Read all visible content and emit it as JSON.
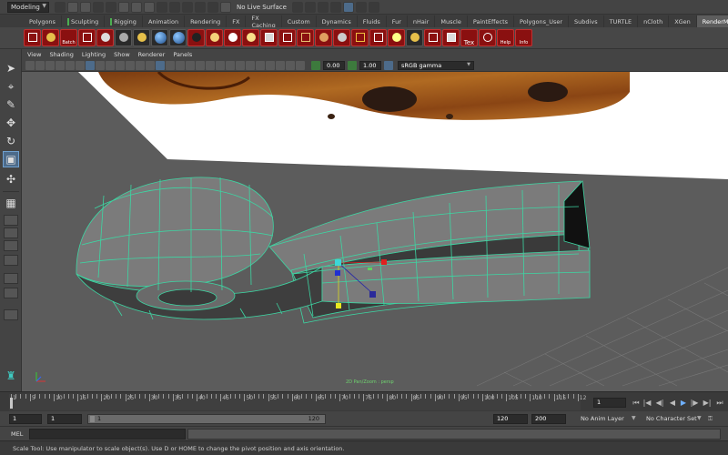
{
  "status_line": {
    "mode": "Modeling",
    "surface": "No Live Surface"
  },
  "shelf_tabs": [
    {
      "label": "Polygons",
      "active": false,
      "mark": false
    },
    {
      "label": "Sculpting",
      "active": false,
      "mark": true
    },
    {
      "label": "Rigging",
      "active": false,
      "mark": true
    },
    {
      "label": "Animation",
      "active": false,
      "mark": false
    },
    {
      "label": "Rendering",
      "active": false,
      "mark": false
    },
    {
      "label": "FX",
      "active": false,
      "mark": false
    },
    {
      "label": "FX Caching",
      "active": false,
      "mark": false
    },
    {
      "label": "Custom",
      "active": false,
      "mark": false
    },
    {
      "label": "Dynamics",
      "active": false,
      "mark": false
    },
    {
      "label": "Fluids",
      "active": false,
      "mark": false
    },
    {
      "label": "Fur",
      "active": false,
      "mark": false
    },
    {
      "label": "nHair",
      "active": false,
      "mark": false
    },
    {
      "label": "Muscle",
      "active": false,
      "mark": false
    },
    {
      "label": "PaintEffects",
      "active": false,
      "mark": false
    },
    {
      "label": "Polygons_User",
      "active": false,
      "mark": false
    },
    {
      "label": "Subdivs",
      "active": false,
      "mark": false
    },
    {
      "label": "TURTLE",
      "active": false,
      "mark": false
    },
    {
      "label": "nCloth",
      "active": false,
      "mark": false
    },
    {
      "label": "XGen",
      "active": false,
      "mark": false
    },
    {
      "label": "RenderMan",
      "active": true,
      "mark": false
    }
  ],
  "shelf_icon_labels": {
    "batch": "Batch",
    "tex": "Tex",
    "help": "Help",
    "info": "Info"
  },
  "panel_menu": [
    "View",
    "Shading",
    "Lighting",
    "Show",
    "Renderer",
    "Panels"
  ],
  "panel_toolbar": {
    "exposure": "0.00",
    "gamma": "1.00",
    "color_space": "sRGB gamma"
  },
  "viewport": {
    "label": "2D Pan/Zoom : persp"
  },
  "time_slider": {
    "tick_labels": [
      "1",
      "5",
      "10",
      "15",
      "20",
      "25",
      "30",
      "35",
      "40",
      "45",
      "50",
      "55",
      "60",
      "65",
      "70",
      "75",
      "80",
      "85",
      "90",
      "95",
      "100",
      "105",
      "110",
      "115",
      "12"
    ],
    "current_frame": "1"
  },
  "range_slider": {
    "start": "1",
    "playback_start": "1",
    "range_start": "1",
    "range_end": "120",
    "playback_end": "120",
    "end": "200",
    "anim_layer": "No Anim Layer",
    "character_set": "No Character Set"
  },
  "command_line": {
    "label": "MEL"
  },
  "help_line": {
    "text": "Scale Tool: Use manipulator to scale object(s). Use D or HOME to change the pivot position and axis orientation."
  },
  "colors": {
    "wireframe": "#3dd6a3",
    "viewport_bg": "#5c5c5c",
    "selection_blue": "#4d6b8a"
  }
}
